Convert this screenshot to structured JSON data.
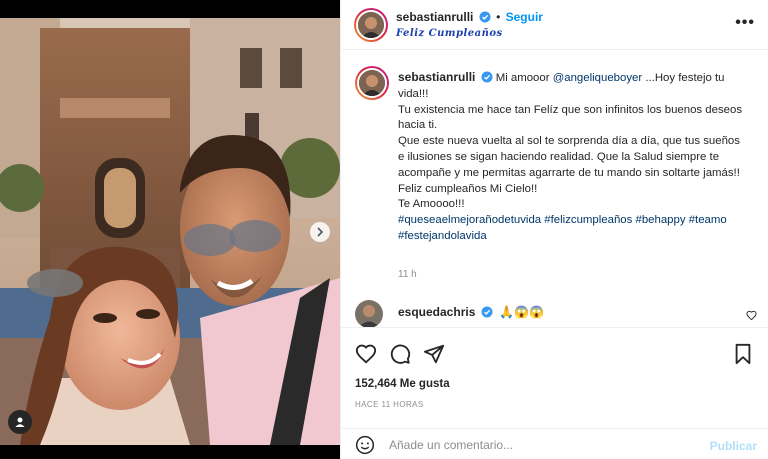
{
  "post": {
    "author": "sebastianrulli",
    "follow_label": "Seguir",
    "subtitle": "Feliz Cumpleaños",
    "more_label": "•••",
    "caption": {
      "author": "sebastianrulli",
      "lead": "Mi amooor ",
      "mention": "@angeliqueboyer",
      "lines": [
        " ...Hoy festejo tu vida!!!",
        "Tu existencia me hace tan Felíz que son infinitos los buenos deseos hacia ti.",
        "Que este nueva vuelta al sol te sorprenda día a día, que tus sueños e ilusiones se sigan haciendo realidad. Que la Salud siempre te acompañe y me permitas agarrarte de tu mando sin soltarte jamás!!",
        "Feliz cumpleaños Mi Cielo!!",
        "Te Amoooo!!!"
      ],
      "hashtags": [
        "#queseaelmejorañodetuvida",
        "#felizcumpleaños",
        "#behappy",
        "#teamo",
        "#festejandolavida"
      ]
    },
    "time_ago": "11 h",
    "comment": {
      "author": "esquedachris",
      "text": "🙏😱😱"
    },
    "likes": "152,464 Me gusta",
    "posted": "HACE 11 HORAS",
    "comment_input": {
      "placeholder": "Añade un comentario...",
      "value": ""
    },
    "publish_label": "Publicar"
  },
  "colors": {
    "link": "#0095f6",
    "mention": "#00376b",
    "muted": "#8e8e8e",
    "verified": "#3897f0",
    "publish_disabled": "#b2dffc"
  },
  "icons": [
    "verified-icon",
    "more-icon",
    "chevron-right-icon",
    "user-tag-icon",
    "heart-icon",
    "comment-icon",
    "share-icon",
    "bookmark-icon",
    "emoji-icon",
    "heart-small-icon"
  ]
}
